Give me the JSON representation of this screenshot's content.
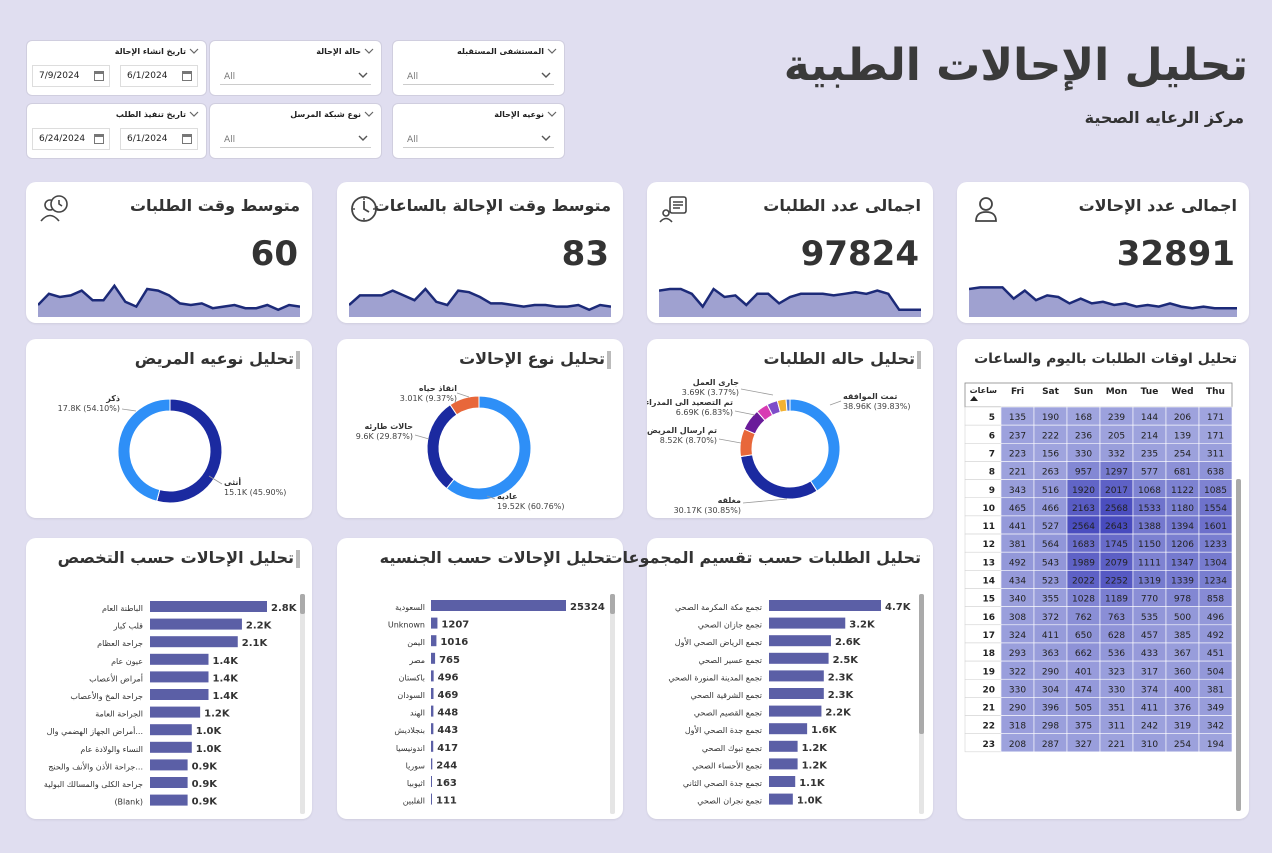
{
  "header": {
    "title": "تحليل الإحالات الطبية",
    "subtitle": "مركز الرعايه الصحية"
  },
  "filters": [
    {
      "label": "تاريخ انشاء الإحالة",
      "type": "date",
      "from": "6/1/2024",
      "to": "7/9/2024"
    },
    {
      "label": "حالة الإحالة",
      "type": "select",
      "value": "All"
    },
    {
      "label": "المستشفى المستقبله",
      "type": "select",
      "value": "All"
    },
    {
      "label": "تاريخ تنفيذ الطلب",
      "type": "date",
      "from": "6/1/2024",
      "to": "6/24/2024"
    },
    {
      "label": "نوع شبكة المرسل",
      "type": "select",
      "value": "All"
    },
    {
      "label": "نوعيه الإحالة",
      "type": "select",
      "value": "All"
    }
  ],
  "kpis": [
    {
      "title": "متوسط وقت الطلبات",
      "value": "60",
      "icon": "user-clock-icon",
      "spark": [
        0.25,
        0.6,
        0.5,
        0.55,
        0.7,
        0.4,
        0.4,
        0.85,
        0.35,
        0.2,
        0.75,
        0.7,
        0.55,
        0.3,
        0.25,
        0.3,
        0.15,
        0.2,
        0.25,
        0.15,
        0.15,
        0.25,
        0.1,
        0.25,
        0.2
      ]
    },
    {
      "title": "متوسط وقت الإحالة بالساعات",
      "value": "83",
      "icon": "clock-icon",
      "spark": [
        0.25,
        0.55,
        0.55,
        0.55,
        0.7,
        0.55,
        0.4,
        0.75,
        0.35,
        0.25,
        0.7,
        0.65,
        0.5,
        0.3,
        0.3,
        0.25,
        0.2,
        0.25,
        0.25,
        0.2,
        0.2,
        0.25,
        0.1,
        0.25,
        0.2
      ]
    },
    {
      "title": "اجمالى عدد الطلبات",
      "value": "97824",
      "icon": "request-list-icon",
      "spark": [
        0.7,
        0.75,
        0.75,
        0.6,
        0.2,
        0.75,
        0.5,
        0.55,
        0.25,
        0.6,
        0.6,
        0.3,
        0.5,
        0.6,
        0.6,
        0.6,
        0.55,
        0.6,
        0.65,
        0.6,
        0.7,
        0.6,
        0.1,
        0.1,
        0.1
      ]
    },
    {
      "title": "اجمالى عدد الإحالات",
      "value": "32891",
      "icon": "user-icon",
      "spark": [
        0.75,
        0.8,
        0.8,
        0.8,
        0.45,
        0.7,
        0.4,
        0.55,
        0.5,
        0.3,
        0.45,
        0.3,
        0.35,
        0.25,
        0.3,
        0.2,
        0.25,
        0.2,
        0.3,
        0.2,
        0.15,
        0.2,
        0.15,
        0.15,
        0.15
      ]
    }
  ],
  "chart_data": [
    {
      "type": "pie",
      "title": "تحليل نوعيه المريض",
      "slices": [
        {
          "label": "ذكر",
          "value": 17.8,
          "display": "17.8K (54.10%)",
          "color": "#1b2aa0"
        },
        {
          "label": "أنثى",
          "value": 15.1,
          "display": "15.1K (45.90%)",
          "color": "#2e8ff7"
        }
      ]
    },
    {
      "type": "pie",
      "title": "تحليل نوع الإحالات",
      "slices": [
        {
          "label": "عاديه",
          "value": 19.52,
          "display": "19.52K (60.76%)",
          "color": "#2e8ff7"
        },
        {
          "label": "حالات طارئه",
          "value": 9.6,
          "display": "9.6K (29.87%)",
          "color": "#1b2aa0"
        },
        {
          "label": "انقاذ حياه",
          "value": 3.01,
          "display": "3.01K (9.37%)",
          "color": "#e8673a"
        }
      ]
    },
    {
      "type": "pie",
      "title": "تحليل حاله الطلبات",
      "slices": [
        {
          "label": "تمت الموافقه",
          "value": 38.96,
          "display": "38.96K (39.83%)",
          "color": "#2e8ff7"
        },
        {
          "label": "مغلقه",
          "value": 30.17,
          "display": "30.17K (30.85%)",
          "color": "#1b2aa0"
        },
        {
          "label": "تم ارسال المريض",
          "value": 8.52,
          "display": "8.52K (8.70%)",
          "color": "#e8673a"
        },
        {
          "label": "تم التصعيد الى المدراء",
          "value": 6.69,
          "display": "6.69K (6.83%)",
          "color": "#6a1b9a"
        },
        {
          "label": "جارى العمل",
          "value": 3.69,
          "display": "3.69K (3.77%)",
          "color": "#d83bb3"
        },
        {
          "label": "",
          "value": 3.3,
          "display": "",
          "color": "#7e4cc9"
        },
        {
          "label": "",
          "value": 2.7,
          "display": "",
          "color": "#f2b233"
        },
        {
          "label": "",
          "value": 1.2,
          "display": "",
          "color": "#4e7bd6"
        }
      ]
    },
    {
      "type": "bar",
      "title": "تحليل الإحالات حسب التخصص",
      "categories": [
        "الباطنة العام",
        "قلب كبار",
        "جراحة العظام",
        "عيون عام",
        "أمراض الأعصاب",
        "جراحة المخ والأعصاب",
        "الجراحة العامة",
        "أمراض الجهاز الهضمي وال...",
        "النساء والولادة عام",
        "جراحة الأذن والأنف والحنج...",
        "جراحة الكلى والمسالك البولية",
        "(Blank)"
      ],
      "values": [
        2.8,
        2.2,
        2.1,
        1.4,
        1.4,
        1.4,
        1.2,
        1.0,
        1.0,
        0.9,
        0.9,
        0.9
      ],
      "labels": [
        "2.8K",
        "2.2K",
        "2.1K",
        "1.4K",
        "1.4K",
        "1.4K",
        "1.2K",
        "1.0K",
        "1.0K",
        "0.9K",
        "0.9K",
        "0.9K"
      ]
    },
    {
      "type": "bar",
      "title": "تحليل الإحالات حسب الجنسيه",
      "categories": [
        "السعودية",
        "Unknown",
        "اليمن",
        "مصر",
        "باكستان",
        "السودان",
        "الهند",
        "بنجلاديش",
        "اندونيسيا",
        "سوريا",
        "اثيوبيا",
        "الفلبين"
      ],
      "values": [
        25324,
        1207,
        1016,
        765,
        496,
        469,
        448,
        443,
        417,
        244,
        163,
        111
      ],
      "labels": [
        "25324",
        "1207",
        "1016",
        "765",
        "496",
        "469",
        "448",
        "443",
        "417",
        "244",
        "163",
        "111"
      ]
    },
    {
      "type": "bar",
      "title": "تحليل الطلبات حسب تقسيم المجموعات",
      "categories": [
        "تجمع مكة المكرمة الصحي",
        "تجمع جازان الصحي",
        "تجمع الرياض الصحي الأول",
        "تجمع عسير الصحي",
        "تجمع المدينة المنورة الصحي",
        "تجمع الشرقية الصحي",
        "تجمع القصيم الصحي",
        "تجمع جدة الصحي الأول",
        "تجمع تبوك الصحي",
        "تجمع الأحساء الصحي",
        "تجمع جدة الصحي الثاني",
        "تجمع نجران الصحي"
      ],
      "values": [
        4.7,
        3.2,
        2.6,
        2.5,
        2.3,
        2.3,
        2.2,
        1.6,
        1.2,
        1.2,
        1.1,
        1.0
      ],
      "labels": [
        "4.7K",
        "3.2K",
        "2.6K",
        "2.5K",
        "2.3K",
        "2.3K",
        "2.2K",
        "1.6K",
        "1.2K",
        "1.2K",
        "1.1K",
        "1.0K"
      ]
    },
    {
      "type": "heatmap",
      "title": "تحليل اوقات الطلبات باليوم والساعات",
      "corner": "ساعات",
      "columns": [
        "Fri",
        "Sat",
        "Sun",
        "Mon",
        "Tue",
        "Wed",
        "Thu"
      ],
      "rows": [
        "5",
        "6",
        "7",
        "8",
        "9",
        "10",
        "11",
        "12",
        "13",
        "14",
        "15",
        "16",
        "17",
        "18",
        "19",
        "20",
        "21",
        "22",
        "23"
      ],
      "values": [
        [
          135,
          190,
          168,
          239,
          144,
          206,
          171
        ],
        [
          237,
          222,
          236,
          205,
          214,
          139,
          171
        ],
        [
          223,
          156,
          330,
          332,
          235,
          254,
          311
        ],
        [
          221,
          263,
          957,
          1297,
          577,
          681,
          638
        ],
        [
          343,
          516,
          1920,
          2017,
          1068,
          1122,
          1085
        ],
        [
          465,
          466,
          2163,
          2568,
          1533,
          1180,
          1554
        ],
        [
          441,
          527,
          2564,
          2643,
          1388,
          1394,
          1601
        ],
        [
          381,
          564,
          1683,
          1745,
          1150,
          1206,
          1233
        ],
        [
          492,
          543,
          1989,
          2079,
          1111,
          1347,
          1304
        ],
        [
          434,
          523,
          2022,
          2252,
          1319,
          1339,
          1234
        ],
        [
          340,
          355,
          1028,
          1189,
          770,
          978,
          858
        ],
        [
          308,
          372,
          762,
          763,
          535,
          500,
          496
        ],
        [
          324,
          411,
          650,
          628,
          457,
          385,
          492
        ],
        [
          293,
          363,
          662,
          536,
          433,
          367,
          451
        ],
        [
          322,
          290,
          401,
          323,
          317,
          360,
          504
        ],
        [
          330,
          304,
          474,
          330,
          374,
          400,
          381
        ],
        [
          290,
          396,
          505,
          351,
          411,
          376,
          349
        ],
        [
          318,
          298,
          375,
          311,
          242,
          319,
          342
        ],
        [
          208,
          287,
          327,
          221,
          310,
          254,
          194
        ]
      ]
    }
  ]
}
